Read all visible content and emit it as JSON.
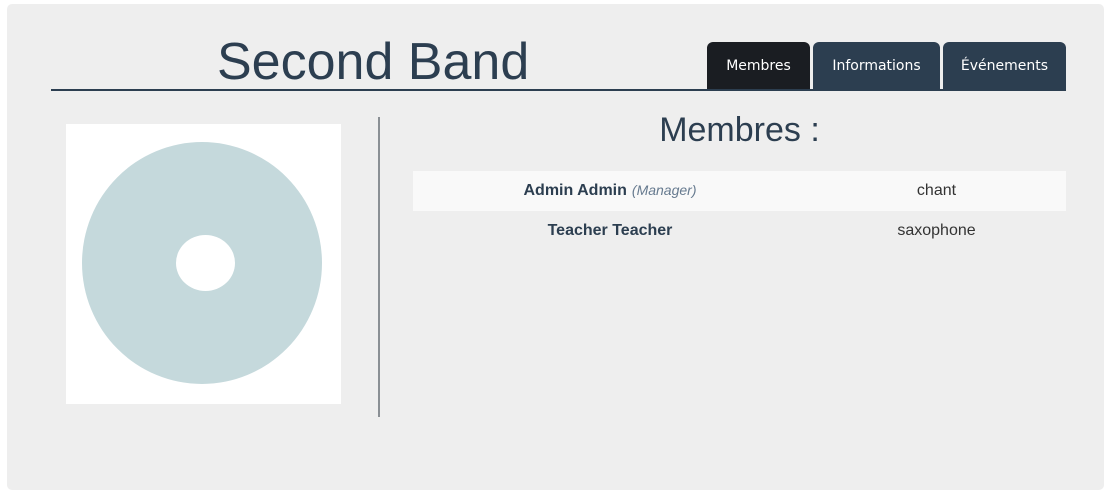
{
  "band": {
    "title": "Second Band"
  },
  "tabs": [
    {
      "label": "Membres",
      "active": true
    },
    {
      "label": "Informations",
      "active": false
    },
    {
      "label": "Événements",
      "active": false
    }
  ],
  "image": {
    "icon": "disc-placeholder-icon",
    "disc_color": "#c5d9dc"
  },
  "members": {
    "heading": "Membres :",
    "rows": [
      {
        "name": "Admin Admin",
        "role": "(Manager)",
        "instrument": "chant"
      },
      {
        "name": "Teacher Teacher",
        "role": "",
        "instrument": "saxophone"
      }
    ]
  },
  "colors": {
    "primary": "#2c3e50",
    "active_tab": "#1a1d22",
    "panel_background": "#eeeeee"
  }
}
